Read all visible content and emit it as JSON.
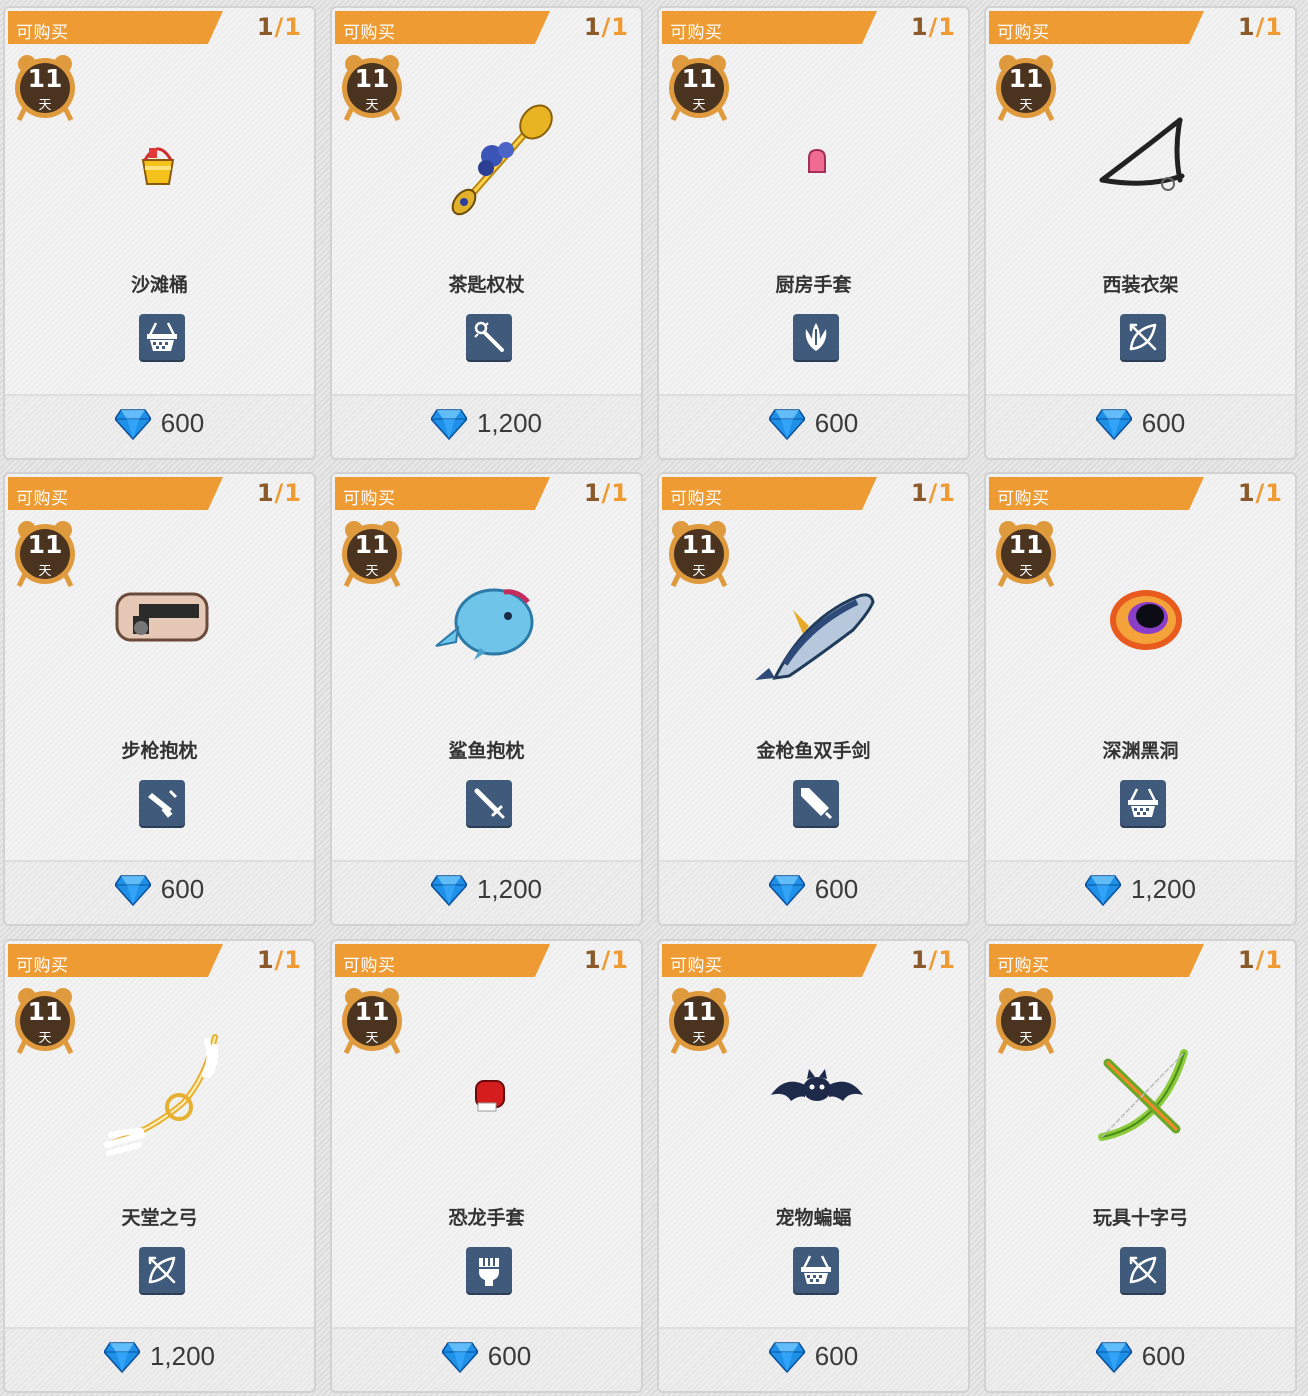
{
  "banner_label": "可购买",
  "stock": {
    "current": "1",
    "separator": "/",
    "max": "1"
  },
  "timer": {
    "days": "11",
    "unit": "天"
  },
  "items": [
    {
      "name": "沙滩桶",
      "type": "basket",
      "price": "600",
      "art": "bucket"
    },
    {
      "name": "茶匙权杖",
      "type": "wand",
      "price": "1,200",
      "art": "scepter"
    },
    {
      "name": "厨房手套",
      "type": "claw",
      "price": "600",
      "art": "mitt-pink"
    },
    {
      "name": "西装衣架",
      "type": "bow",
      "price": "600",
      "art": "hanger"
    },
    {
      "name": "步枪抱枕",
      "type": "gun",
      "price": "600",
      "art": "gun-pillow"
    },
    {
      "name": "鲨鱼抱枕",
      "type": "sword",
      "price": "1,200",
      "art": "shark"
    },
    {
      "name": "金枪鱼双手剑",
      "type": "greatsword",
      "price": "600",
      "art": "tuna"
    },
    {
      "name": "深渊黑洞",
      "type": "basket",
      "price": "1,200",
      "art": "blackhole"
    },
    {
      "name": "天堂之弓",
      "type": "bow",
      "price": "1,200",
      "art": "wingbow"
    },
    {
      "name": "恐龙手套",
      "type": "fist",
      "price": "600",
      "art": "glove-red"
    },
    {
      "name": "宠物蝙蝠",
      "type": "basket",
      "price": "600",
      "art": "bat"
    },
    {
      "name": "玩具十字弓",
      "type": "bow",
      "price": "600",
      "art": "crossbow"
    }
  ],
  "colors": {
    "banner": "#ee9b34",
    "icon_bg": "#3f5a7a",
    "timer_ring": "#e09a3e",
    "timer_face": "#4a3420",
    "gem": "#1e90e8"
  }
}
